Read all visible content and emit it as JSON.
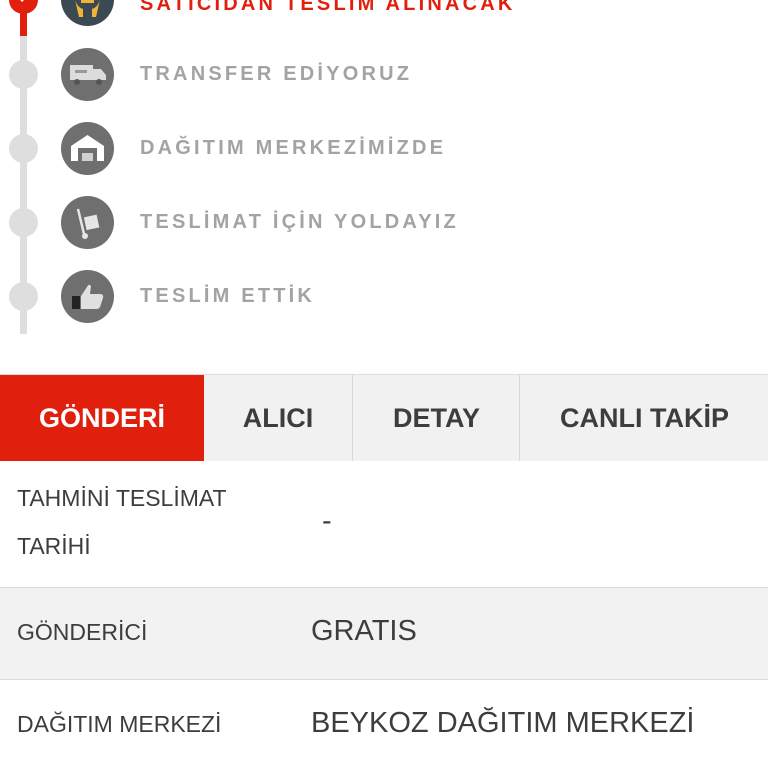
{
  "timeline": {
    "steps": [
      {
        "label": "SATICIDAN TESLİM ALINACAK",
        "icon": "hands-icon",
        "active": true
      },
      {
        "label": "TRANSFER EDİYORUZ",
        "icon": "truck-icon",
        "active": false
      },
      {
        "label": "DAĞITIM MERKEZİMİZDE",
        "icon": "warehouse-icon",
        "active": false
      },
      {
        "label": "TESLİMAT İÇİN YOLDAYIZ",
        "icon": "hand-truck-icon",
        "active": false
      },
      {
        "label": "TESLİM ETTİK",
        "icon": "thumbs-up-icon",
        "active": false
      }
    ]
  },
  "tabs": [
    {
      "label": "GÖNDERİ",
      "active": true
    },
    {
      "label": "ALICI",
      "active": false
    },
    {
      "label": "DETAY",
      "active": false
    },
    {
      "label": "CANLI TAKİP",
      "active": false
    }
  ],
  "details": {
    "rows": [
      {
        "label_line1": "TAHMİNİ TESLİMAT",
        "label_line2": "TARİHİ",
        "value": "-"
      },
      {
        "label": "GÖNDERİCİ",
        "value": "GRATIS"
      },
      {
        "label": "DAĞITIM MERKEZİ",
        "value": "BEYKOZ DAĞITIM MERKEZİ"
      }
    ]
  },
  "colors": {
    "accent": "#e0200d",
    "muted_text": "#a3a3a3",
    "text": "#3d3d3d",
    "timeline_grey": "#dedede",
    "icon_circle": "#6f6f6f"
  }
}
